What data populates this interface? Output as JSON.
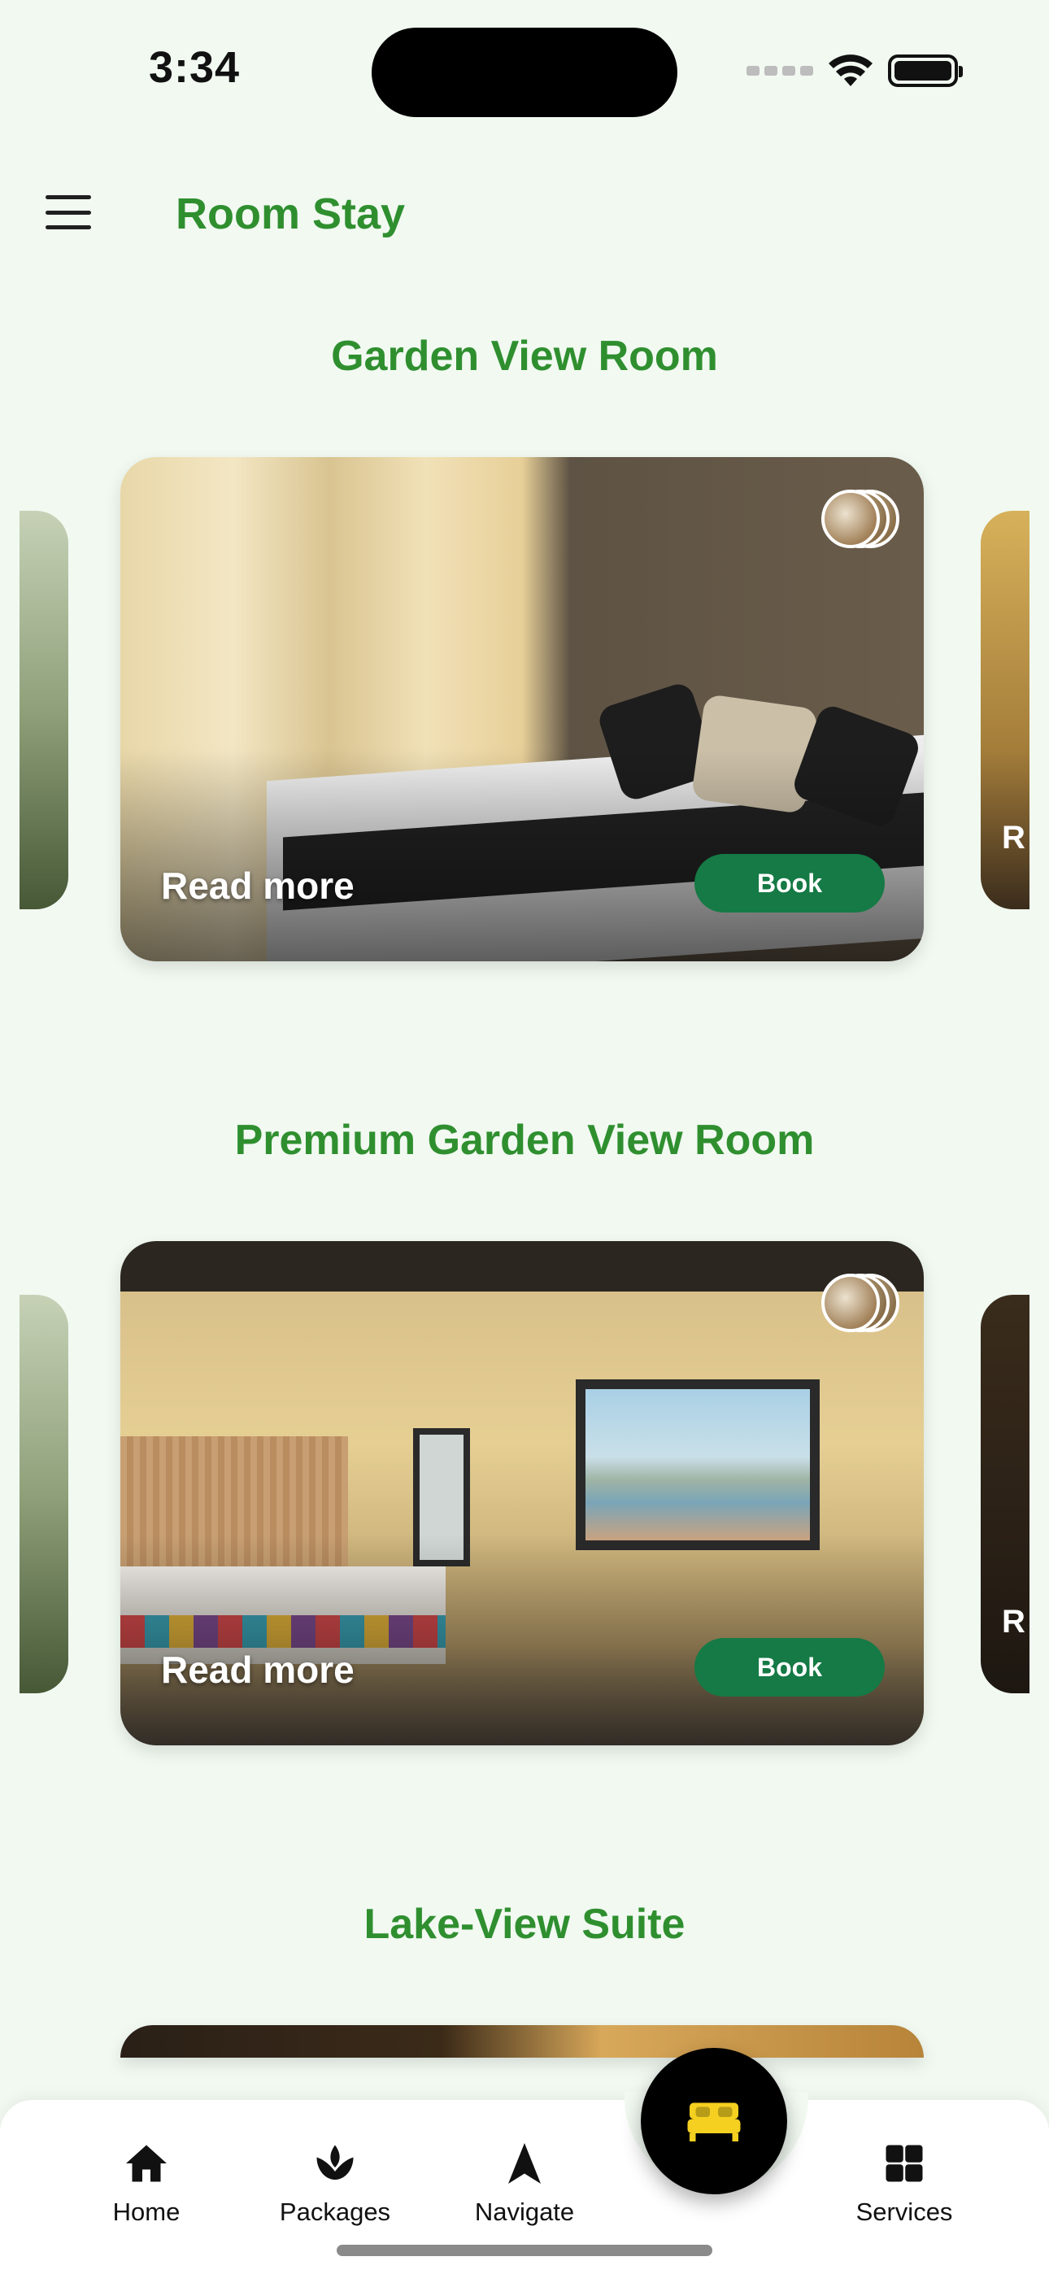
{
  "status_bar": {
    "time": "3:34"
  },
  "app_bar": {
    "title": "Room Stay"
  },
  "rooms": [
    {
      "title": "Garden View Room",
      "read_more": "Read more",
      "book": "Book"
    },
    {
      "title": "Premium Garden View Room",
      "read_more": "Read more",
      "book": "Book"
    },
    {
      "title": "Lake-View Suite"
    }
  ],
  "side_peek_letter": "R",
  "bottom_nav": {
    "items": [
      {
        "label": "Home",
        "icon": "home-icon"
      },
      {
        "label": "Packages",
        "icon": "lotus-icon"
      },
      {
        "label": "Navigate",
        "icon": "navigation-arrow-icon"
      },
      {
        "label": "Services",
        "icon": "grid-icon"
      }
    ],
    "center_button_icon": "bed-icon"
  },
  "colors": {
    "background": "#f1f9f1",
    "accent_green": "#2f8f2f",
    "book_button": "#157a45",
    "fab_icon": "#f5d020"
  }
}
